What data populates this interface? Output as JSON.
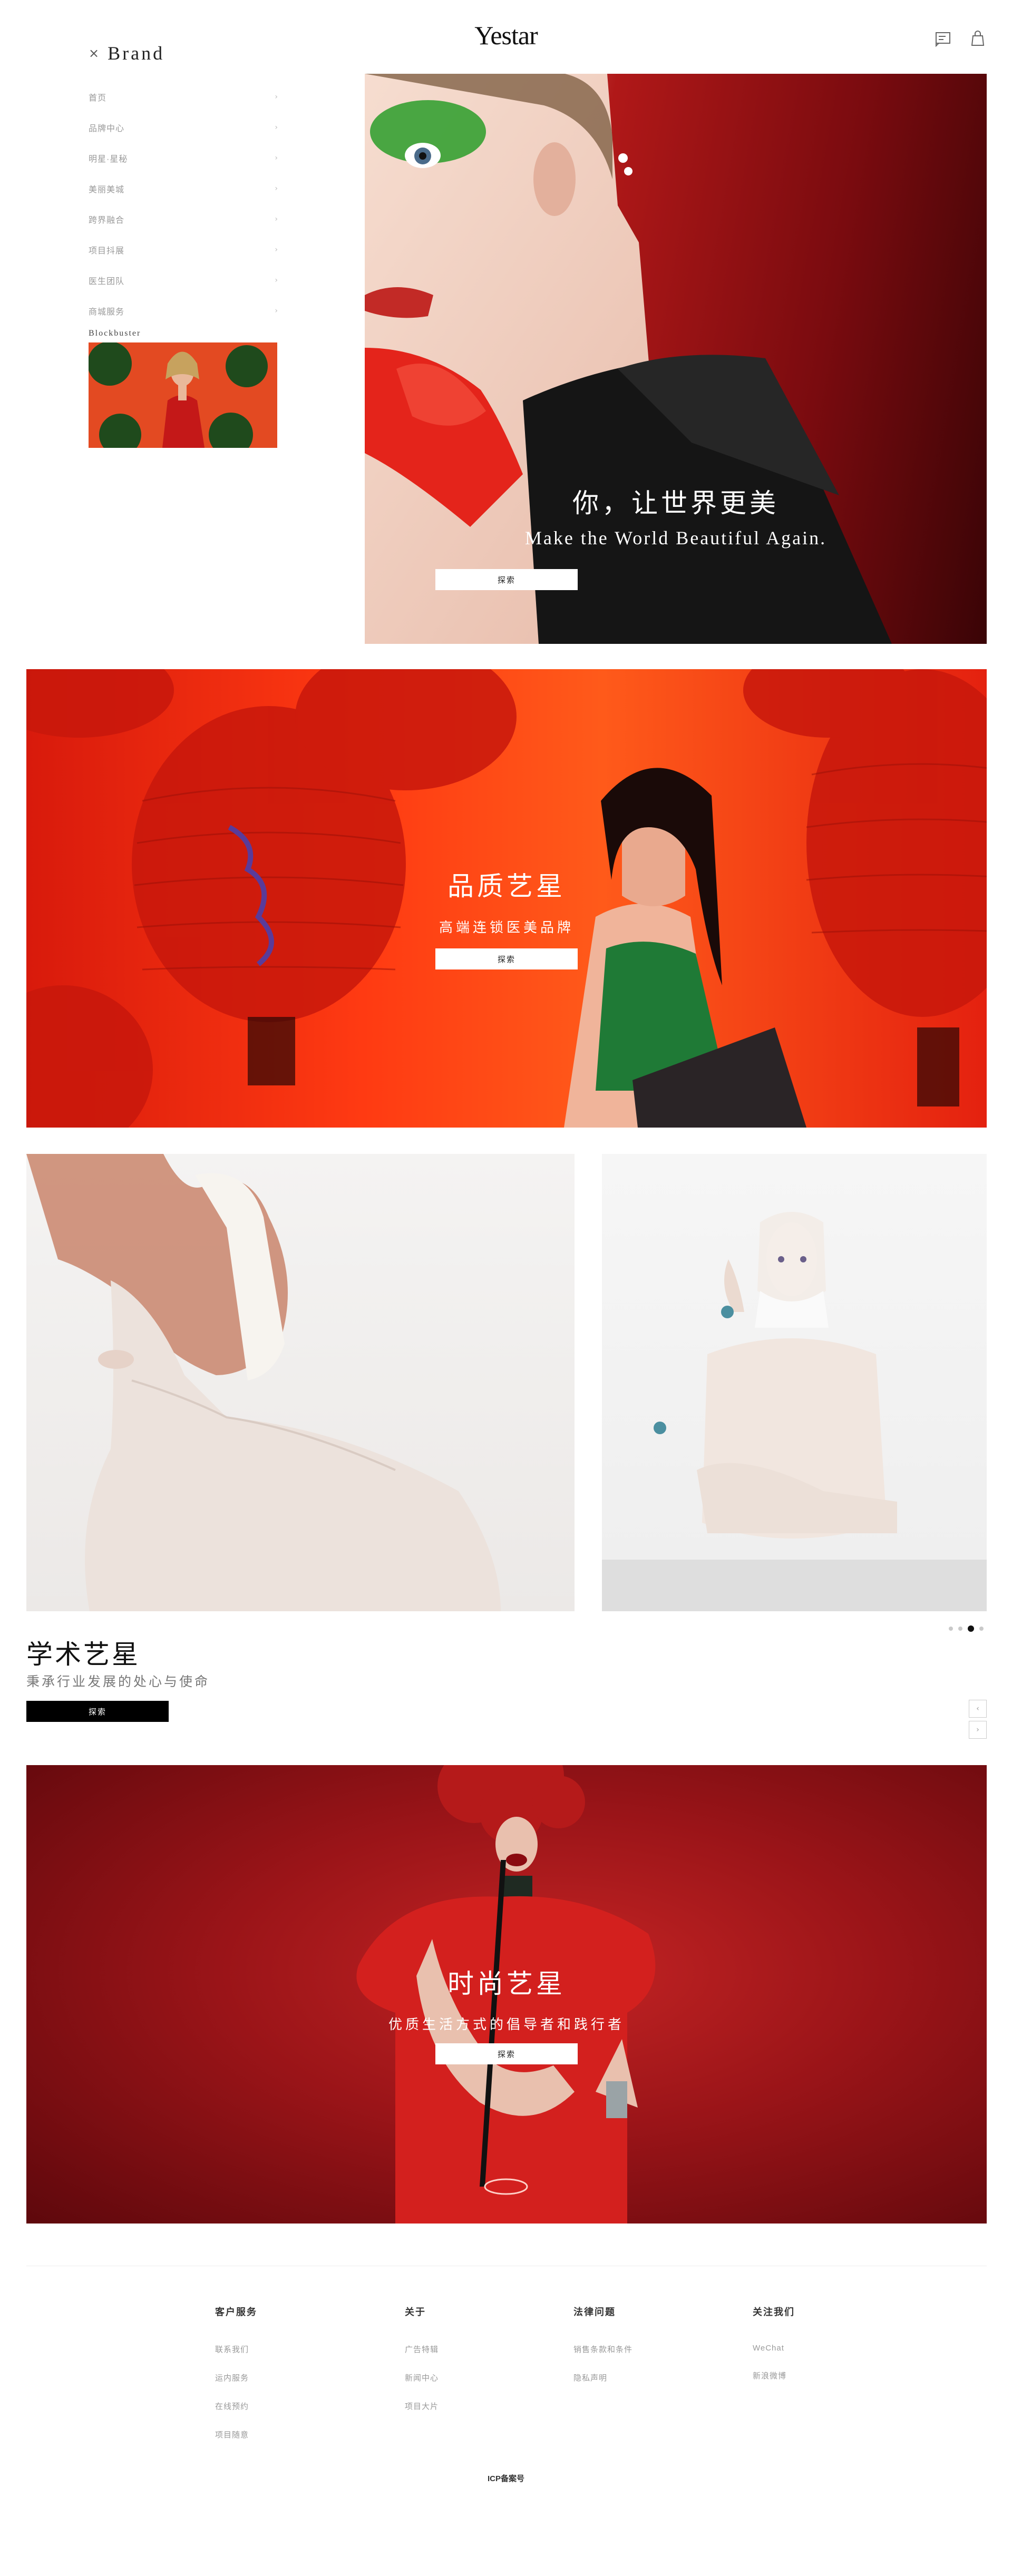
{
  "header": {
    "logo": "Yestar",
    "icons": [
      "message-icon",
      "shopping-bag-icon"
    ]
  },
  "sidebar": {
    "close_glyph": "×",
    "brand_label": "Brand",
    "items": [
      {
        "label": "首页"
      },
      {
        "label": "品牌中心"
      },
      {
        "label": "明星·星秘"
      },
      {
        "label": "美丽美城"
      },
      {
        "label": "跨界融合"
      },
      {
        "label": "项目抖展"
      },
      {
        "label": "医生团队"
      },
      {
        "label": "商城服务"
      }
    ],
    "blockbuster_label": "Blockbuster"
  },
  "hero": {
    "title_cn": "你，让世界更美",
    "title_en": "Make the World Beautiful Again.",
    "button": "探索"
  },
  "quality": {
    "title": "品质艺星",
    "subtitle": "高端连锁医美品牌",
    "button": "探索"
  },
  "academic": {
    "title": "学术艺星",
    "subtitle": "秉承行业发展的处心与使命",
    "button": "探索",
    "carousel_pages": 4,
    "carousel_active": 3
  },
  "fashion": {
    "title": "时尚艺星",
    "subtitle": "优质生活方式的倡导者和践行者",
    "button": "探索"
  },
  "footer": {
    "columns": [
      {
        "heading": "客户服务",
        "links": [
          "联系我们",
          "运内服务",
          "在线预约",
          "项目随意"
        ]
      },
      {
        "heading": "关于",
        "links": [
          "广告特辑",
          "新闻中心",
          "项目大片"
        ]
      },
      {
        "heading": "法律问题",
        "links": [
          "销售条款和条件",
          "隐私声明"
        ]
      },
      {
        "heading": "关注我们",
        "links": [
          "WeChat",
          "新浪微博"
        ]
      }
    ],
    "icp": "ICP备案号"
  },
  "colors": {
    "hero_red": "#b01818",
    "banner_orange": "#ff3a12",
    "fashion_red": "#9a1418",
    "button_black": "#000000",
    "button_white": "#ffffff"
  }
}
